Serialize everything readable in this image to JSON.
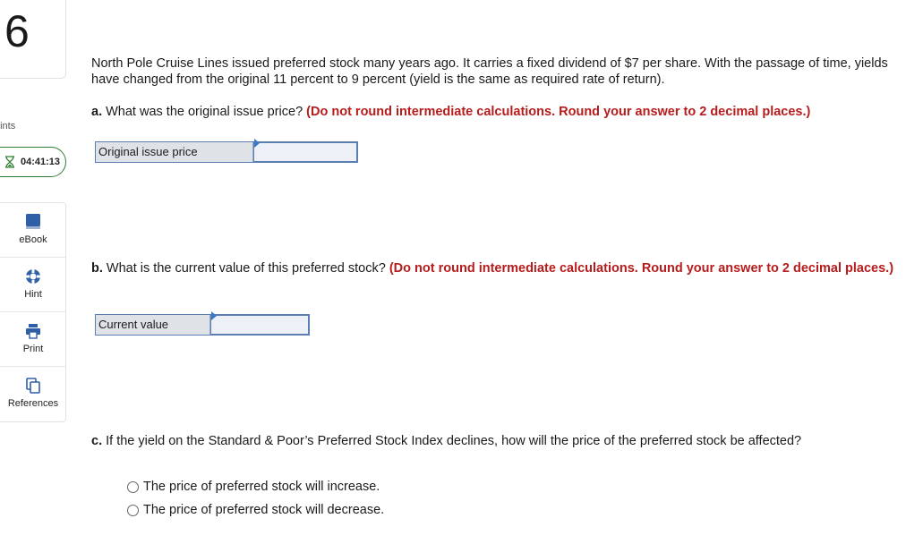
{
  "question_number": "6",
  "points_label": "oints",
  "timer": "04:41:13",
  "tools": [
    {
      "label": "eBook",
      "icon": "book-icon"
    },
    {
      "label": "Hint",
      "icon": "lifebuoy-icon"
    },
    {
      "label": "Print",
      "icon": "printer-icon"
    },
    {
      "label": "References",
      "icon": "documents-icon"
    }
  ],
  "intro": "North Pole Cruise Lines issued preferred stock many years ago. It carries a fixed dividend of $7 per share. With the passage of time, yields have changed from the original 11 percent to 9 percent (yield is the same as required rate of return).",
  "part_a": {
    "prefix": "a.",
    "question": " What was the original issue price? ",
    "instruction": "(Do not round intermediate calculations. Round your answer to 2 decimal places.)",
    "label": "Original issue price",
    "value": ""
  },
  "part_b": {
    "prefix": "b.",
    "question": " What is the current value of this preferred stock? ",
    "instruction": "(Do not round intermediate calculations. Round your answer to 2 decimal places.)",
    "label": "Current value",
    "value": ""
  },
  "part_c": {
    "prefix": "c.",
    "question": " If the yield on the Standard & Poor’s Preferred Stock Index declines, how will the price of the preferred stock be affected?",
    "options": [
      "The price of preferred stock will increase.",
      "The price of preferred stock will decrease."
    ]
  },
  "colors": {
    "accent_red": "#b71c1c",
    "timer_border": "#2e7d32",
    "tool_icon_blue": "#2f5fa7",
    "input_border": "#5b7fb0"
  }
}
